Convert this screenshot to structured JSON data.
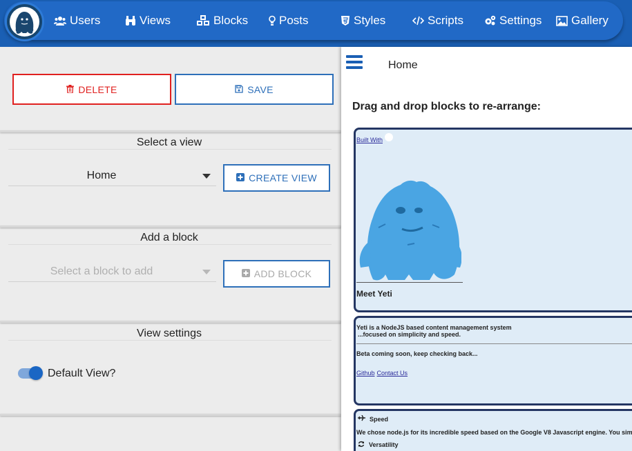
{
  "nav": {
    "items": [
      {
        "label": "Users",
        "icon": "users-icon"
      },
      {
        "label": "Views",
        "icon": "binoculars-icon"
      },
      {
        "label": "Blocks",
        "icon": "cubes-icon"
      },
      {
        "label": "Posts",
        "icon": "lightbulb-icon"
      },
      {
        "label": "Styles",
        "icon": "css3-icon"
      },
      {
        "label": "Scripts",
        "icon": "code-icon"
      },
      {
        "label": "Settings",
        "icon": "gears-icon"
      },
      {
        "label": "Gallery",
        "icon": "image-icon"
      }
    ]
  },
  "actions": {
    "delete_label": "DELETE",
    "save_label": "SAVE"
  },
  "select_view": {
    "title": "Select a view",
    "selected": "Home",
    "create_label": "CREATE VIEW"
  },
  "add_block": {
    "title": "Add a block",
    "placeholder": "Select a block to add",
    "add_label": "ADD BLOCK"
  },
  "view_settings": {
    "title": "View settings",
    "default_view_label": "Default View?",
    "default_view_on": true
  },
  "preview": {
    "title": "Home",
    "instruction": "Drag and drop blocks to re-arrange:",
    "block1": {
      "built_with": "Built With",
      "heading": "Meet Yeti"
    },
    "block2": {
      "line1": "Yeti is a NodeJS based content management system",
      "line2": "...focused on simplicity and speed.",
      "line3": "Beta coming soon, keep checking back...",
      "link1": "Github",
      "link2": "Contact Us"
    },
    "block3": {
      "speed_label": "Speed",
      "speed_desc": "We chose node.js for its incredible speed based on the Google V8 Javascript engine. You sim",
      "versatility_label": "Versatility"
    }
  },
  "colors": {
    "nav_bg": "#1a5fb4",
    "accent": "#2d6fb9",
    "danger": "#e0201f",
    "block_border": "#243663",
    "block_bg": "#dfecf7",
    "yeti_blue": "#4aa5e3"
  }
}
